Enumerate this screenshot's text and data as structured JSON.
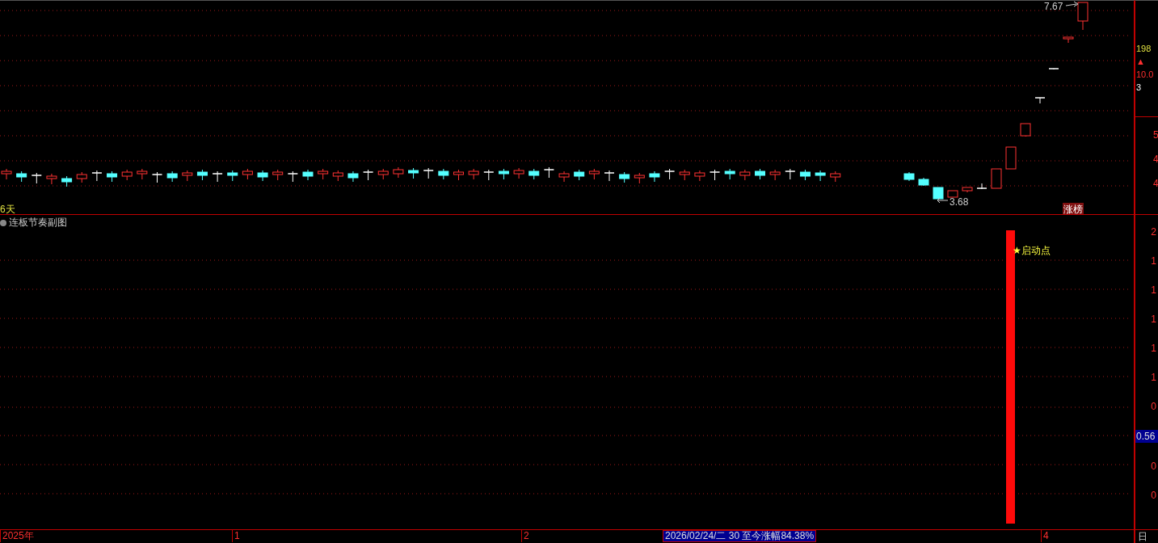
{
  "main_chart": {
    "high_label": "7.67",
    "low_label": "3.68",
    "days_label": "6天",
    "tag": "涨榜"
  },
  "sub_chart": {
    "title": "连板节奏副图",
    "marker_label": "★启动点"
  },
  "right_axis_top": [
    {
      "text": "198",
      "kind": "volume"
    },
    {
      "text": "▲",
      "kind": "up"
    },
    {
      "text": "10.0",
      "kind": "change"
    },
    {
      "text": "3",
      "kind": "plain"
    }
  ],
  "price_axis": [
    "5",
    "4",
    "4"
  ],
  "sub_axis": [
    {
      "text": "2",
      "highlighted": false
    },
    {
      "text": "1",
      "highlighted": false
    },
    {
      "text": "1",
      "highlighted": false
    },
    {
      "text": "1",
      "highlighted": false
    },
    {
      "text": "1",
      "highlighted": false
    },
    {
      "text": "1",
      "highlighted": false
    },
    {
      "text": "0",
      "highlighted": false
    },
    {
      "text": "0.56",
      "highlighted": true
    },
    {
      "text": "0",
      "highlighted": false
    },
    {
      "text": "0",
      "highlighted": false
    }
  ],
  "time_axis": [
    {
      "text": "2025年",
      "kind": "label"
    },
    {
      "text": "1",
      "kind": "label"
    },
    {
      "text": "2",
      "kind": "label"
    },
    {
      "text": "2026/02/24/二 30 至今涨幅84.38%",
      "kind": "cursor"
    },
    {
      "text": "4",
      "kind": "label"
    }
  ],
  "period_button": "日"
}
